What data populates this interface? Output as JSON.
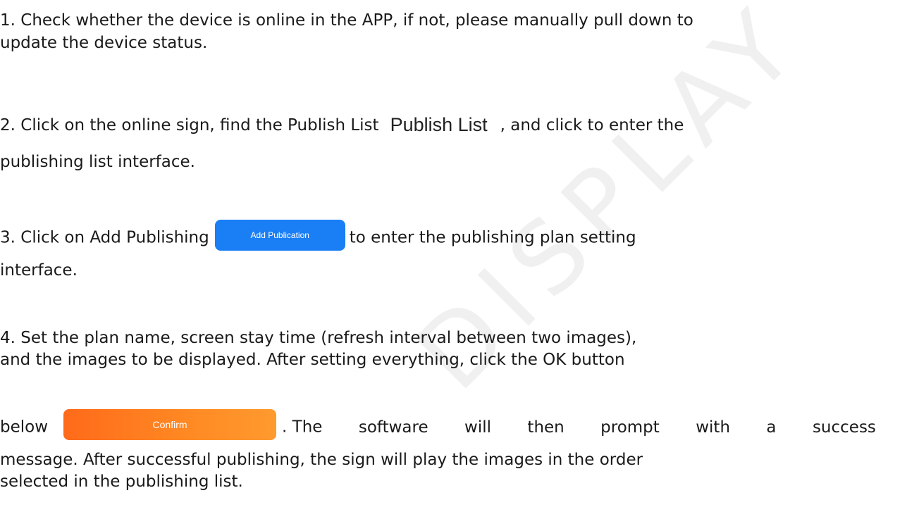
{
  "steps": {
    "step1": {
      "line1": "1. Check whether the device is online in the APP, if not, please manually pull down to",
      "line2": "update the device status."
    },
    "step2": {
      "before_label": "2. Click on the online sign, find the Publish List",
      "publish_list_label": "Publish List",
      "after_label": ", and click to enter the",
      "line2": "publishing list interface."
    },
    "step3": {
      "before_button": "3. Click on Add Publishing",
      "add_publication_button": "Add Publication",
      "after_button": "to enter the publishing plan setting",
      "line2": "interface."
    },
    "step4": {
      "line1": "4. Set the plan name, screen stay time (refresh interval between two images),",
      "line2": "and the images to be displayed. After setting everything, click the OK button",
      "before_button": "below",
      "confirm_button": "Confirm",
      "after_words": [
        ". The",
        "software",
        "will",
        "then",
        "prompt",
        "with",
        "a",
        "success"
      ],
      "line4": "message. After successful publishing, the sign will play the images in the order",
      "line5": "selected in the publishing list."
    }
  },
  "watermark": "DISPLAY",
  "colors": {
    "button_blue": "#1a7ef5",
    "button_orange": "#ff7a1f",
    "text": "#1a1a1a"
  }
}
